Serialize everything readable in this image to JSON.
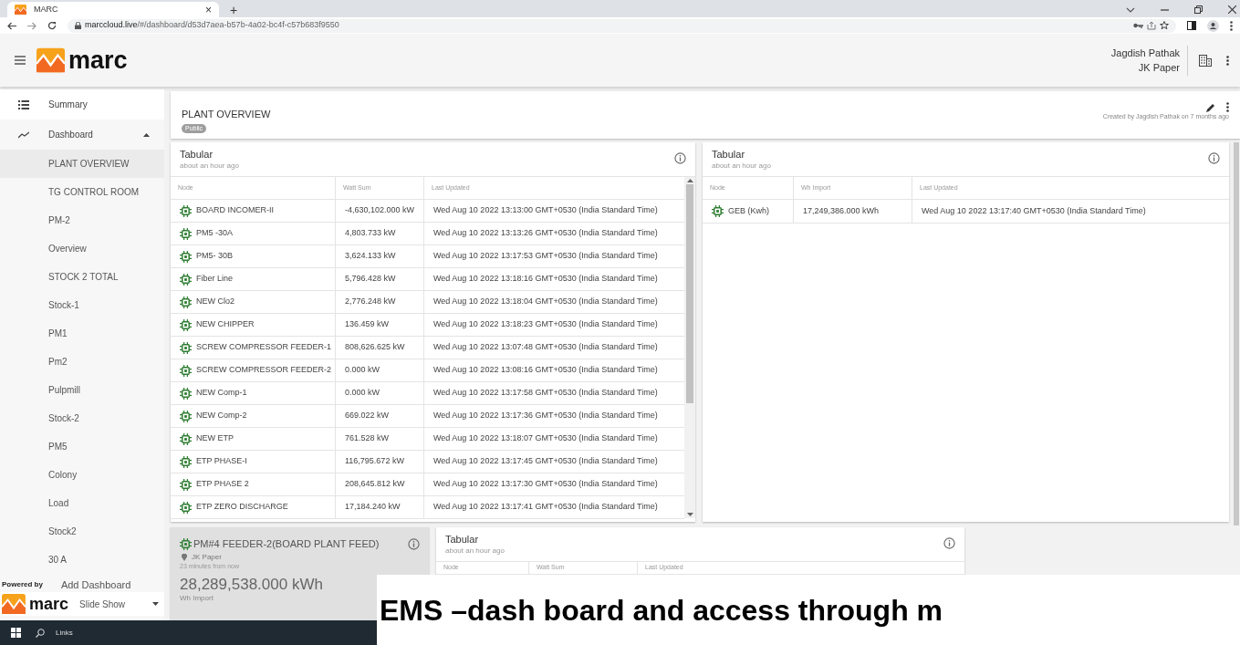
{
  "browser": {
    "tab_title": "MARC",
    "tab_close": "×",
    "new_tab": "+",
    "url_host": "marccloud.live",
    "url_path": "/#/dashboard/d53d7aea-b57b-4a02-bc4f-c57b683f9550"
  },
  "app": {
    "logo_text": "marc",
    "user_name": "Jagdish Pathak",
    "org": "JK Paper"
  },
  "sidebar": {
    "items": [
      {
        "label": "Summary",
        "kind": "list"
      },
      {
        "label": "Dashboard",
        "kind": "chart",
        "expanded": true,
        "children": [
          {
            "label": "PLANT OVERVIEW",
            "selected": true
          },
          {
            "label": "TG CONTROL ROOM",
            "selected": false
          },
          {
            "label": "PM-2",
            "selected": false
          },
          {
            "label": "Overview",
            "selected": false
          },
          {
            "label": "STOCK 2 TOTAL",
            "selected": false
          },
          {
            "label": "Stock-1",
            "selected": false
          },
          {
            "label": "PM1",
            "selected": false
          },
          {
            "label": "Pm2",
            "selected": false
          },
          {
            "label": "Pulpmill",
            "selected": false
          },
          {
            "label": "Stock-2",
            "selected": false
          },
          {
            "label": "PM5",
            "selected": false
          },
          {
            "label": "Colony",
            "selected": false
          },
          {
            "label": "Load",
            "selected": false
          },
          {
            "label": "Stock2",
            "selected": false
          },
          {
            "label": "30 A",
            "selected": false
          }
        ]
      }
    ],
    "add_dashboard": "Add Dashboard",
    "slide_show": "Slide Show",
    "powered_by": "Powered by",
    "powered_logo": "marc"
  },
  "dashboard": {
    "title": "PLANT OVERVIEW",
    "badge": "Public",
    "created": "Created by Jagdish Pathak on 7 months ago"
  },
  "table_1": {
    "title": "Tabular",
    "subtitle": "about an hour ago",
    "columns": [
      "Node",
      "Watt Sum",
      "Last Updated"
    ],
    "rows": [
      [
        "BOARD INCOMER-II",
        "-4,630,102.000 kW",
        "Wed Aug 10 2022 13:13:00 GMT+0530 (India Standard Time)"
      ],
      [
        "PM5 -30A",
        "4,803.733 kW",
        "Wed Aug 10 2022 13:13:26 GMT+0530 (India Standard Time)"
      ],
      [
        "PM5- 30B",
        "3,624.133 kW",
        "Wed Aug 10 2022 13:17:53 GMT+0530 (India Standard Time)"
      ],
      [
        "Fiber Line",
        "5,796.428 kW",
        "Wed Aug 10 2022 13:18:16 GMT+0530 (India Standard Time)"
      ],
      [
        "NEW Clo2",
        "2,776.248 kW",
        "Wed Aug 10 2022 13:18:04 GMT+0530 (India Standard Time)"
      ],
      [
        "NEW CHIPPER",
        "136.459 kW",
        "Wed Aug 10 2022 13:18:23 GMT+0530 (India Standard Time)"
      ],
      [
        "SCREW COMPRESSOR FEEDER-1",
        "808,626.625 kW",
        "Wed Aug 10 2022 13:07:48 GMT+0530 (India Standard Time)"
      ],
      [
        "SCREW COMPRESSOR FEEDER-2",
        "0.000 kW",
        "Wed Aug 10 2022 13:08:16 GMT+0530 (India Standard Time)"
      ],
      [
        "NEW Comp-1",
        "0.000 kW",
        "Wed Aug 10 2022 13:17:58 GMT+0530 (India Standard Time)"
      ],
      [
        "NEW Comp-2",
        "669.022 kW",
        "Wed Aug 10 2022 13:17:36 GMT+0530 (India Standard Time)"
      ],
      [
        "NEW ETP",
        "761.528 kW",
        "Wed Aug 10 2022 13:18:07 GMT+0530 (India Standard Time)"
      ],
      [
        "ETP PHASE-I",
        "116,795.672 kW",
        "Wed Aug 10 2022 13:17:45 GMT+0530 (India Standard Time)"
      ],
      [
        "ETP PHASE 2",
        "208,645.812 kW",
        "Wed Aug 10 2022 13:17:30 GMT+0530 (India Standard Time)"
      ],
      [
        "ETP ZERO DISCHARGE",
        "17,184.240 kW",
        "Wed Aug 10 2022 13:17:41 GMT+0530 (India Standard Time)"
      ]
    ]
  },
  "table_2": {
    "title": "Tabular",
    "subtitle": "about an hour ago",
    "columns": [
      "Node",
      "Wh Import",
      "Last Updated"
    ],
    "rows": [
      [
        "GEB (Kwh)",
        "17,249,386.000 kWh",
        "Wed Aug 10 2022 13:17:40 GMT+0530 (India Standard Time)"
      ]
    ]
  },
  "meter_card": {
    "title": "PM#4 FEEDER-2(BOARD PLANT FEED)",
    "location": "JK Paper",
    "time": "23 minutes from now",
    "value": "28,289,538.000 kWh",
    "value_label": "Wh Import"
  },
  "table_3": {
    "title": "Tabular",
    "subtitle": "about an hour ago",
    "columns": [
      "Node",
      "Watt Sum",
      "Last Updated"
    ]
  },
  "taskbar": {
    "search_label": "Links"
  },
  "caption": "EMS –dash board and access through m"
}
